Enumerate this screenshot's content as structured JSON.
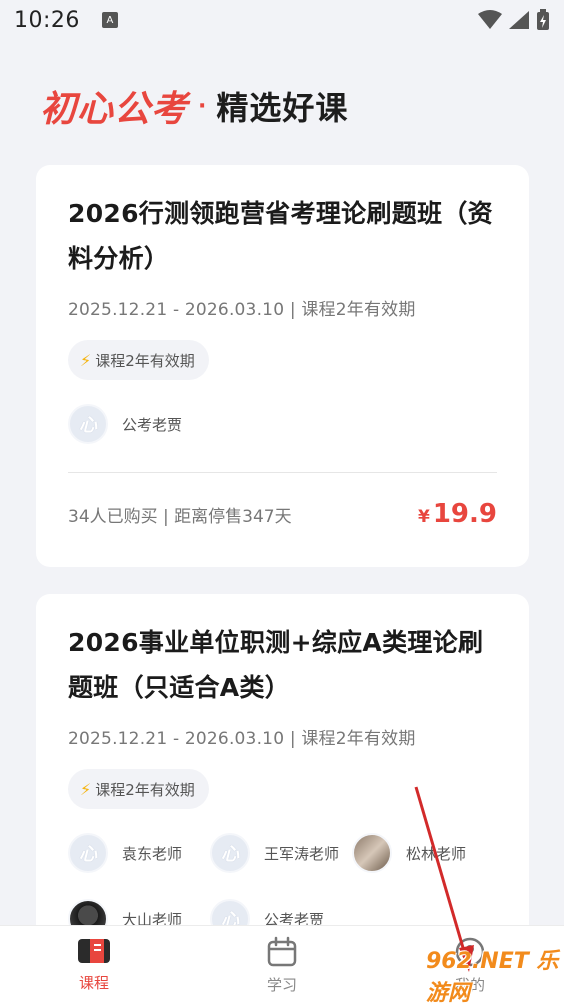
{
  "status_bar": {
    "time": "10:26",
    "notification_label": "A"
  },
  "header": {
    "brand": "初心公考",
    "separator": "·",
    "title": "精选好课"
  },
  "courses": [
    {
      "title": "2026行测领跑营省考理论刷题班（资料分析）",
      "meta": "2025.12.21 - 2026.03.10 | 课程2年有效期",
      "tag": "课程2年有效期",
      "teachers": [
        {
          "name": "公考老贾",
          "avatar_text": "心"
        }
      ],
      "sales": "34人已购买 | 距离停售347天",
      "price_symbol": "¥",
      "price": "19.9"
    },
    {
      "title": "2026事业单位职测+综应A类理论刷题班（只适合A类）",
      "meta": "2025.12.21 - 2026.03.10 | 课程2年有效期",
      "tag": "课程2年有效期",
      "teachers": [
        {
          "name": "袁东老师",
          "avatar_text": "心"
        },
        {
          "name": "王军涛老师",
          "avatar_text": "心"
        },
        {
          "name": "松林老师",
          "avatar_text": ""
        },
        {
          "name": "大山老师",
          "avatar_text": ""
        },
        {
          "name": "公考老贾",
          "avatar_text": "心"
        }
      ]
    }
  ],
  "tabs": [
    {
      "label": "课程",
      "icon": "course-book-icon",
      "active": true
    },
    {
      "label": "学习",
      "icon": "calendar-icon",
      "active": false
    },
    {
      "label": "我的",
      "icon": "profile-icon",
      "active": false
    }
  ],
  "watermark": "962.NET 乐游网",
  "colors": {
    "accent": "#e8463e",
    "background": "#f2f3f7",
    "tag_bolt": "#f5b40f"
  }
}
